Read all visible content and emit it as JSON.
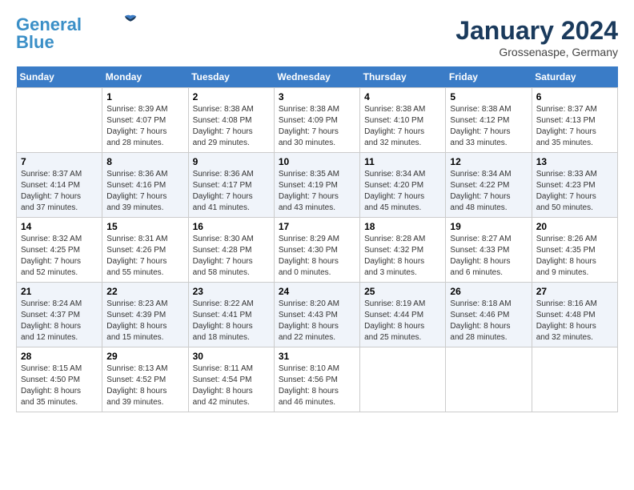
{
  "header": {
    "logo_line1": "General",
    "logo_line2": "Blue",
    "month": "January 2024",
    "location": "Grossenaspe, Germany"
  },
  "weekdays": [
    "Sunday",
    "Monday",
    "Tuesday",
    "Wednesday",
    "Thursday",
    "Friday",
    "Saturday"
  ],
  "weeks": [
    [
      {
        "day": "",
        "info": ""
      },
      {
        "day": "1",
        "info": "Sunrise: 8:39 AM\nSunset: 4:07 PM\nDaylight: 7 hours\nand 28 minutes."
      },
      {
        "day": "2",
        "info": "Sunrise: 8:38 AM\nSunset: 4:08 PM\nDaylight: 7 hours\nand 29 minutes."
      },
      {
        "day": "3",
        "info": "Sunrise: 8:38 AM\nSunset: 4:09 PM\nDaylight: 7 hours\nand 30 minutes."
      },
      {
        "day": "4",
        "info": "Sunrise: 8:38 AM\nSunset: 4:10 PM\nDaylight: 7 hours\nand 32 minutes."
      },
      {
        "day": "5",
        "info": "Sunrise: 8:38 AM\nSunset: 4:12 PM\nDaylight: 7 hours\nand 33 minutes."
      },
      {
        "day": "6",
        "info": "Sunrise: 8:37 AM\nSunset: 4:13 PM\nDaylight: 7 hours\nand 35 minutes."
      }
    ],
    [
      {
        "day": "7",
        "info": "Sunrise: 8:37 AM\nSunset: 4:14 PM\nDaylight: 7 hours\nand 37 minutes."
      },
      {
        "day": "8",
        "info": "Sunrise: 8:36 AM\nSunset: 4:16 PM\nDaylight: 7 hours\nand 39 minutes."
      },
      {
        "day": "9",
        "info": "Sunrise: 8:36 AM\nSunset: 4:17 PM\nDaylight: 7 hours\nand 41 minutes."
      },
      {
        "day": "10",
        "info": "Sunrise: 8:35 AM\nSunset: 4:19 PM\nDaylight: 7 hours\nand 43 minutes."
      },
      {
        "day": "11",
        "info": "Sunrise: 8:34 AM\nSunset: 4:20 PM\nDaylight: 7 hours\nand 45 minutes."
      },
      {
        "day": "12",
        "info": "Sunrise: 8:34 AM\nSunset: 4:22 PM\nDaylight: 7 hours\nand 48 minutes."
      },
      {
        "day": "13",
        "info": "Sunrise: 8:33 AM\nSunset: 4:23 PM\nDaylight: 7 hours\nand 50 minutes."
      }
    ],
    [
      {
        "day": "14",
        "info": "Sunrise: 8:32 AM\nSunset: 4:25 PM\nDaylight: 7 hours\nand 52 minutes."
      },
      {
        "day": "15",
        "info": "Sunrise: 8:31 AM\nSunset: 4:26 PM\nDaylight: 7 hours\nand 55 minutes."
      },
      {
        "day": "16",
        "info": "Sunrise: 8:30 AM\nSunset: 4:28 PM\nDaylight: 7 hours\nand 58 minutes."
      },
      {
        "day": "17",
        "info": "Sunrise: 8:29 AM\nSunset: 4:30 PM\nDaylight: 8 hours\nand 0 minutes."
      },
      {
        "day": "18",
        "info": "Sunrise: 8:28 AM\nSunset: 4:32 PM\nDaylight: 8 hours\nand 3 minutes."
      },
      {
        "day": "19",
        "info": "Sunrise: 8:27 AM\nSunset: 4:33 PM\nDaylight: 8 hours\nand 6 minutes."
      },
      {
        "day": "20",
        "info": "Sunrise: 8:26 AM\nSunset: 4:35 PM\nDaylight: 8 hours\nand 9 minutes."
      }
    ],
    [
      {
        "day": "21",
        "info": "Sunrise: 8:24 AM\nSunset: 4:37 PM\nDaylight: 8 hours\nand 12 minutes."
      },
      {
        "day": "22",
        "info": "Sunrise: 8:23 AM\nSunset: 4:39 PM\nDaylight: 8 hours\nand 15 minutes."
      },
      {
        "day": "23",
        "info": "Sunrise: 8:22 AM\nSunset: 4:41 PM\nDaylight: 8 hours\nand 18 minutes."
      },
      {
        "day": "24",
        "info": "Sunrise: 8:20 AM\nSunset: 4:43 PM\nDaylight: 8 hours\nand 22 minutes."
      },
      {
        "day": "25",
        "info": "Sunrise: 8:19 AM\nSunset: 4:44 PM\nDaylight: 8 hours\nand 25 minutes."
      },
      {
        "day": "26",
        "info": "Sunrise: 8:18 AM\nSunset: 4:46 PM\nDaylight: 8 hours\nand 28 minutes."
      },
      {
        "day": "27",
        "info": "Sunrise: 8:16 AM\nSunset: 4:48 PM\nDaylight: 8 hours\nand 32 minutes."
      }
    ],
    [
      {
        "day": "28",
        "info": "Sunrise: 8:15 AM\nSunset: 4:50 PM\nDaylight: 8 hours\nand 35 minutes."
      },
      {
        "day": "29",
        "info": "Sunrise: 8:13 AM\nSunset: 4:52 PM\nDaylight: 8 hours\nand 39 minutes."
      },
      {
        "day": "30",
        "info": "Sunrise: 8:11 AM\nSunset: 4:54 PM\nDaylight: 8 hours\nand 42 minutes."
      },
      {
        "day": "31",
        "info": "Sunrise: 8:10 AM\nSunset: 4:56 PM\nDaylight: 8 hours\nand 46 minutes."
      },
      {
        "day": "",
        "info": ""
      },
      {
        "day": "",
        "info": ""
      },
      {
        "day": "",
        "info": ""
      }
    ]
  ]
}
